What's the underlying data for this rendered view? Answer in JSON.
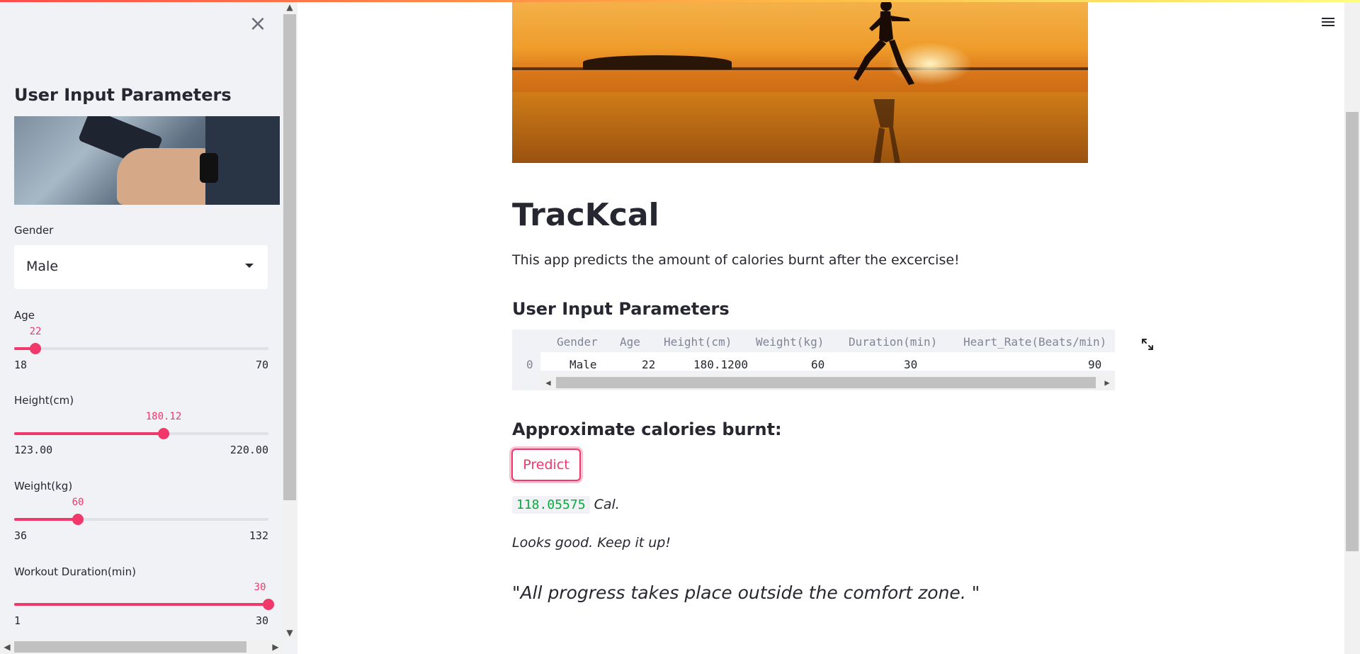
{
  "sidebar": {
    "title": "User Input Parameters",
    "gender": {
      "label": "Gender",
      "value": "Male"
    },
    "age": {
      "label": "Age",
      "value": "22",
      "min": "18",
      "max": "70",
      "fraction": 0.0833
    },
    "height": {
      "label": "Height(cm)",
      "value": "180.12",
      "min": "123.00",
      "max": "220.00",
      "fraction": 0.5889
    },
    "weight": {
      "label": "Weight(kg)",
      "value": "60",
      "min": "36",
      "max": "132",
      "fraction": 0.25
    },
    "duration": {
      "label": "Workout Duration(min)",
      "value": "30",
      "min": "1",
      "max": "30",
      "fraction": 1.0
    }
  },
  "main": {
    "title": "TracKcal",
    "description": "This app predicts the amount of calories burnt after the excercise!",
    "params_heading": "User Input Parameters",
    "table": {
      "columns": [
        "Gender",
        "Age",
        "Height(cm)",
        "Weight(kg)",
        "Duration(min)",
        "Heart_Rate(Beats/min)"
      ],
      "rows": [
        {
          "index": "0",
          "cells": [
            "Male",
            "22",
            "180.1200",
            "60",
            "30",
            "90"
          ]
        }
      ]
    },
    "calories_heading": "Approximate calories burnt:",
    "predict_label": "Predict",
    "result_value": "118.05575",
    "result_unit": "Cal.",
    "feedback": "Looks good. Keep it up!",
    "quote": "\"All progress takes place outside the comfort zone. \""
  },
  "colors": {
    "accent": "#f0386b",
    "sidebar_bg": "#f0f2f6",
    "result_green": "#09ab3b"
  }
}
